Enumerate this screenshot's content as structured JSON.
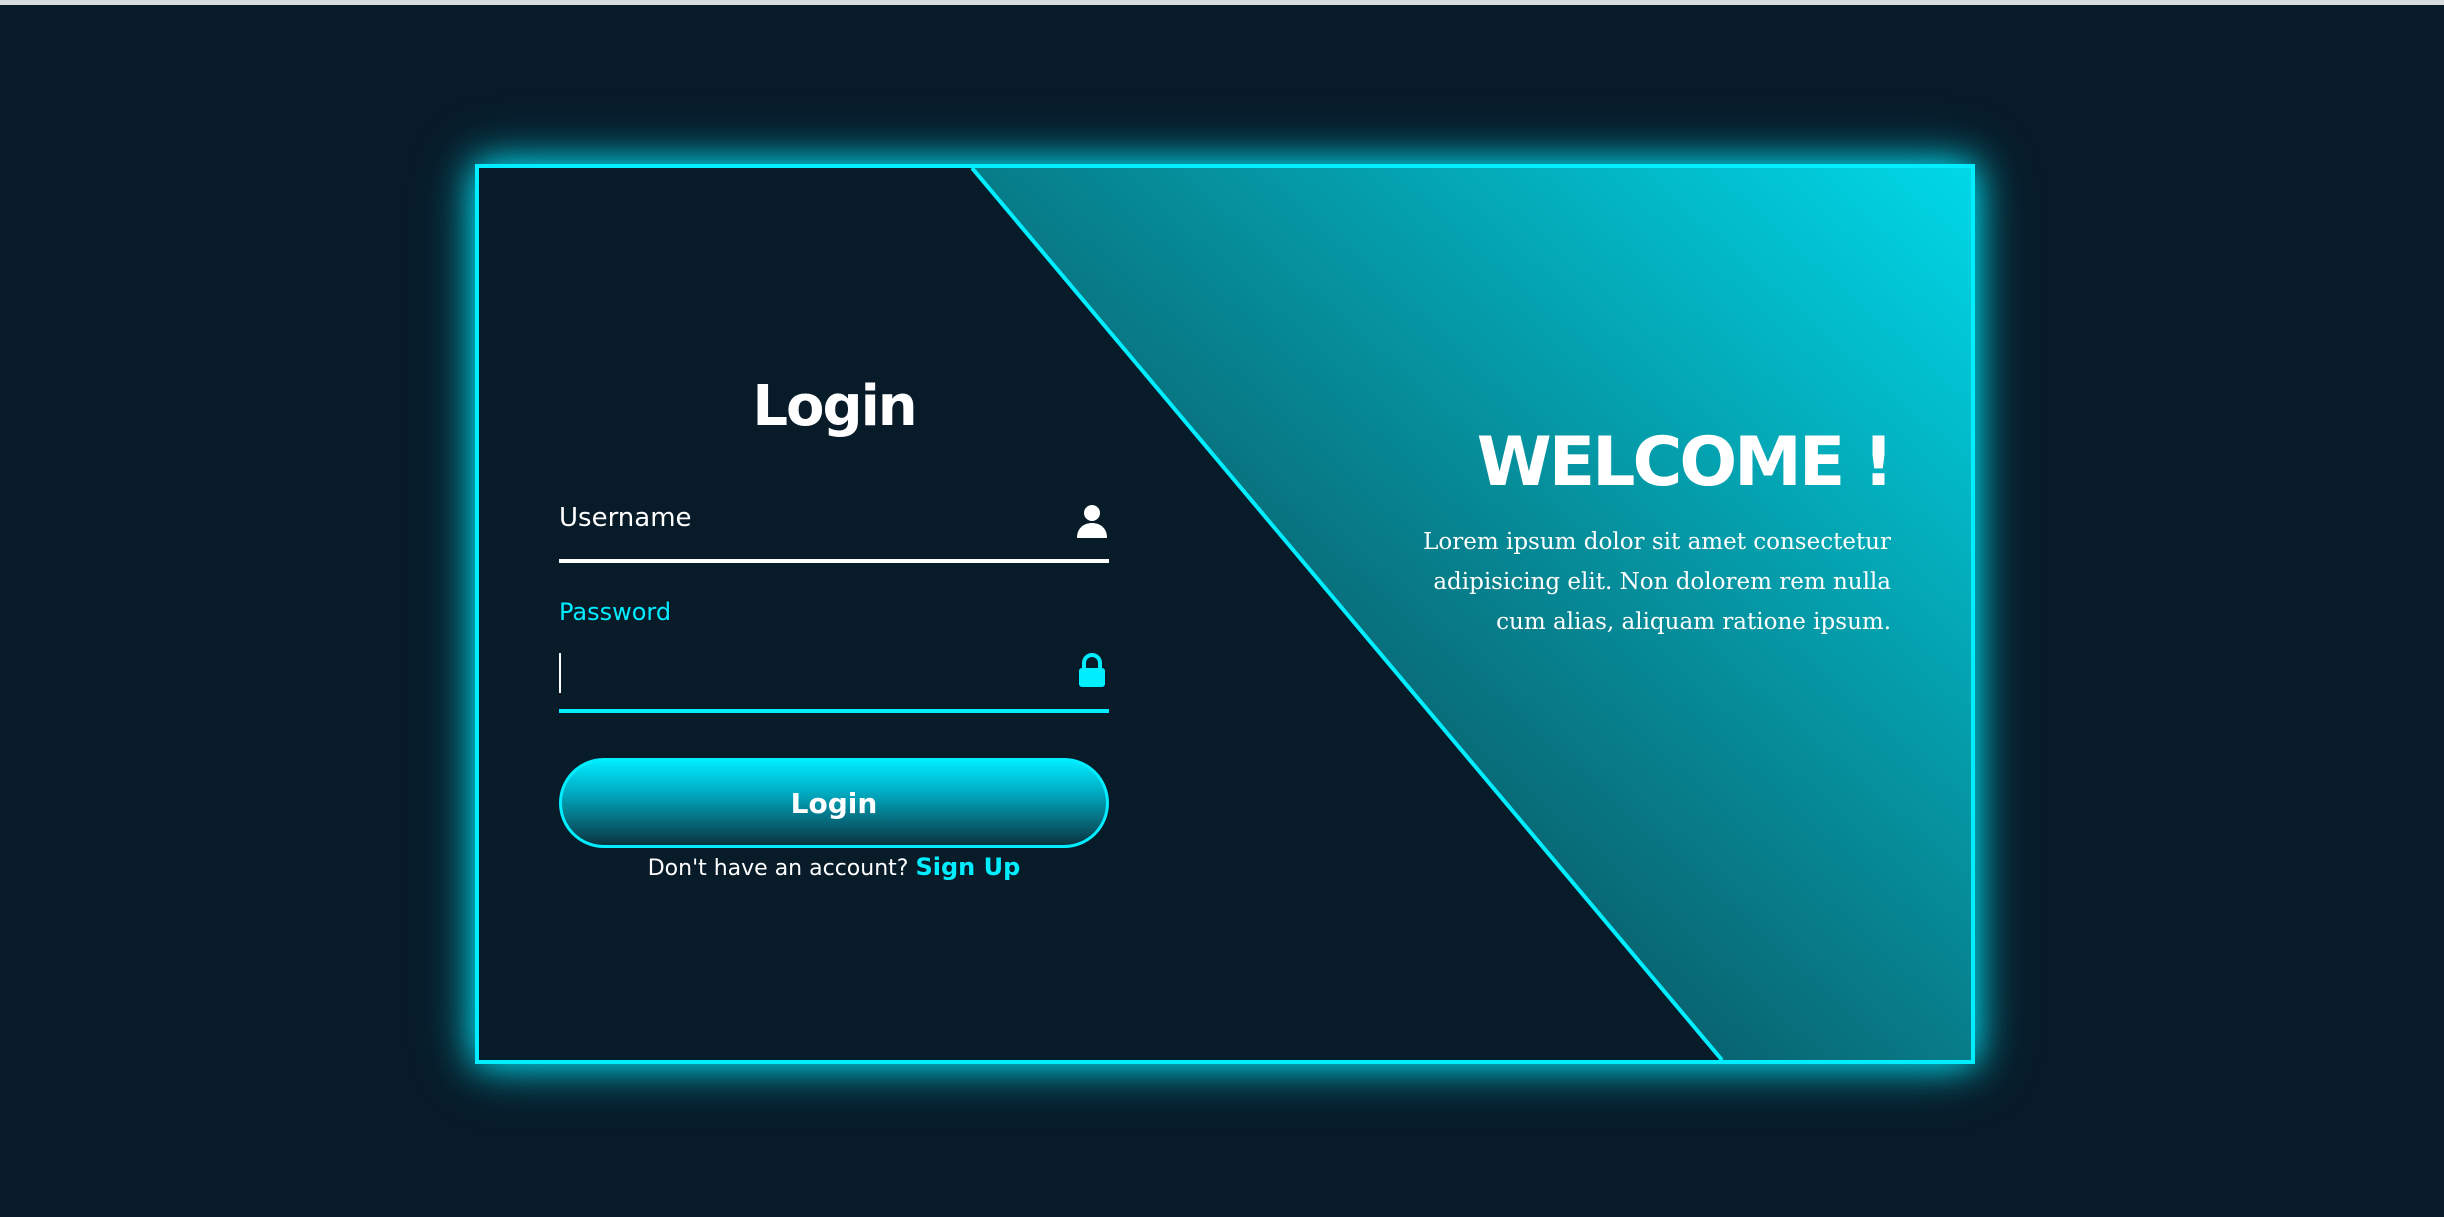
{
  "colors": {
    "background": "#081b29",
    "accent": "#00eeff",
    "text": "#ffffff"
  },
  "login": {
    "title": "Login",
    "username_label": "Username",
    "password_label": "Password",
    "username_value": "",
    "password_value": "",
    "button_label": "Login",
    "signup_prompt": "Don't have an account?",
    "signup_link": "Sign Up",
    "username_icon": "user-icon",
    "password_icon": "lock-icon"
  },
  "welcome": {
    "title": "WELCOME !",
    "text": "Lorem ipsum dolor sit amet consectetur adipisicing elit. Non dolorem rem nulla cum alias, aliquam ratione ipsum."
  }
}
